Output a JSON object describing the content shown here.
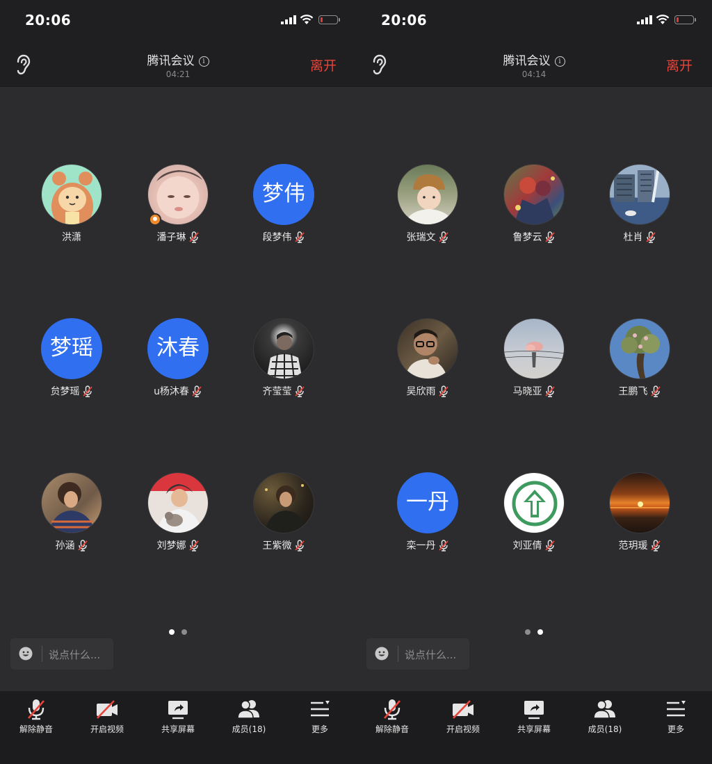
{
  "screens": [
    {
      "time": "20:06",
      "title": "腾讯会议",
      "timer": "04:21",
      "leave": "离开",
      "page_dots": {
        "total": 2,
        "active": 1
      },
      "participants": [
        {
          "name": "洪潇",
          "muted": false,
          "avatar": "cartoon-bear-avatar"
        },
        {
          "name": "潘子琳",
          "muted": true,
          "avatar": "baby-photo-avatar",
          "host": true
        },
        {
          "name": "段梦伟",
          "muted": true,
          "avatar_text": "梦伟"
        },
        {
          "name": "贠梦瑶",
          "muted": true,
          "avatar_text": "梦瑶"
        },
        {
          "name": "u杨沐春",
          "muted": true,
          "avatar_text": "沐春"
        },
        {
          "name": "齐莹莹",
          "muted": true,
          "avatar": "singer-photo-avatar"
        },
        {
          "name": "孙涵",
          "muted": true,
          "avatar": "curly-hair-photo-avatar"
        },
        {
          "name": "刘梦娜",
          "muted": true,
          "avatar": "cat-photo-avatar"
        },
        {
          "name": "王紫微",
          "muted": true,
          "avatar": "dark-portrait-avatar"
        }
      ]
    },
    {
      "time": "20:06",
      "title": "腾讯会议",
      "timer": "04:14",
      "leave": "离开",
      "page_dots": {
        "total": 2,
        "active": 2
      },
      "participants": [
        {
          "name": "张瑞文",
          "muted": true,
          "avatar": "child-hat-photo-avatar"
        },
        {
          "name": "鲁梦云",
          "muted": true,
          "avatar": "anime-art-avatar"
        },
        {
          "name": "杜肖",
          "muted": true,
          "avatar": "building-photo-avatar"
        },
        {
          "name": "吴欣雨",
          "muted": true,
          "avatar": "glasses-man-photo-avatar"
        },
        {
          "name": "马晓亚",
          "muted": true,
          "avatar": "sky-cloud-avatar"
        },
        {
          "name": "王鹏飞",
          "muted": true,
          "avatar": "tree-photo-avatar"
        },
        {
          "name": "栾一丹",
          "muted": true,
          "avatar_text": "一丹"
        },
        {
          "name": "刘亚倩",
          "muted": true,
          "avatar": "green-arrow-avatar"
        },
        {
          "name": "范玥瑗",
          "muted": true,
          "avatar": "sunset-avatar"
        }
      ]
    }
  ],
  "chat_placeholder": "说点什么...",
  "toolbar": [
    {
      "label": "解除静音",
      "icon": "mic-off-icon"
    },
    {
      "label": "开启视频",
      "icon": "video-off-icon"
    },
    {
      "label": "共享屏幕",
      "icon": "share-screen-icon"
    },
    {
      "label": "成员(18)",
      "icon": "members-icon"
    },
    {
      "label": "更多",
      "icon": "more-menu-icon"
    }
  ],
  "colors": {
    "accent_blue": "#2f6ff0",
    "leave_red": "#e8443a",
    "background": "#2c2c2e"
  }
}
